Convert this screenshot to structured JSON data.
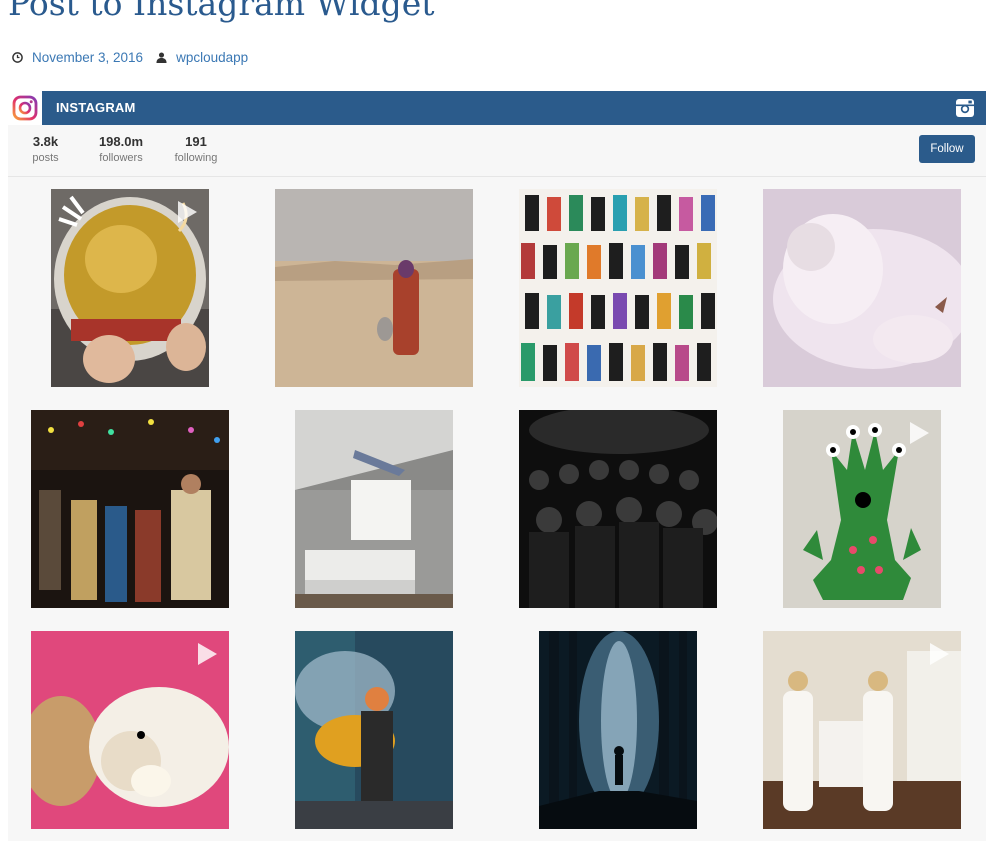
{
  "page": {
    "title": "Post to Instagram Widget"
  },
  "meta": {
    "date": "November 3, 2016",
    "author": "wpcloudapp",
    "date_icon": "clock-icon",
    "author_icon": "user-icon"
  },
  "widget": {
    "header_title": "INSTAGRAM",
    "stats": [
      {
        "value": "3.8k",
        "label": "posts"
      },
      {
        "value": "198.0m",
        "label": "followers"
      },
      {
        "value": "191",
        "label": "following"
      }
    ],
    "follow_label": "Follow",
    "colors": {
      "header": "#2b5b8b",
      "background": "#f7f7f7",
      "link": "#3b78b4",
      "title": "#2a5a8e"
    },
    "photos": [
      {
        "subject": "astronaut-helmet",
        "video": true
      },
      {
        "subject": "desert-woman",
        "video": false
      },
      {
        "subject": "portrait-illustrations",
        "video": false
      },
      {
        "subject": "smoke-figure",
        "video": false
      },
      {
        "subject": "festival-street",
        "video": false
      },
      {
        "subject": "levitating-bedroom",
        "video": false
      },
      {
        "subject": "dark-crowd",
        "video": false
      },
      {
        "subject": "green-hand-monster",
        "video": true
      },
      {
        "subject": "guinea-pigs",
        "video": true
      },
      {
        "subject": "smoke-skull",
        "video": false
      },
      {
        "subject": "forest-silhouette",
        "video": false
      },
      {
        "subject": "twins-kitchen",
        "video": true
      }
    ]
  }
}
